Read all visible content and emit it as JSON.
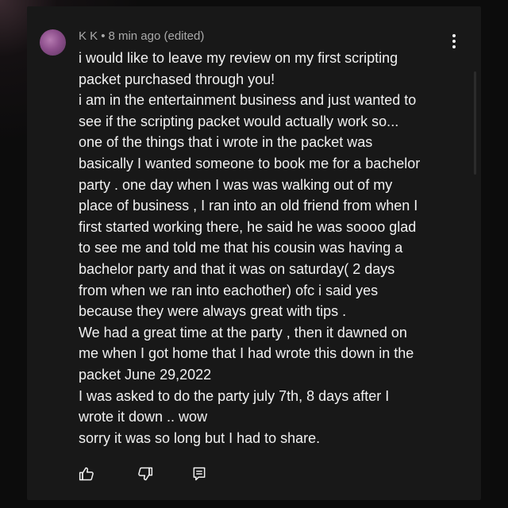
{
  "comment": {
    "author": "K K",
    "separator": "•",
    "timestamp": "8 min ago (edited)",
    "lines": [
      "i would like to leave my review on my first scripting",
      "packet purchased through you!",
      "i am in the entertainment business and just wanted to",
      "see if the scripting packet would actually work so...",
      "one of the things that i wrote in the packet was",
      "basically I wanted someone to book me for a bachelor",
      "party . one day when I was was walking out of my",
      "place of business , I ran into an old friend from when I",
      "first started working there, he said he was soooo glad",
      "to see me and told me that his cousin was having a",
      "bachelor party and that it was on saturday( 2 days",
      "from when we ran into eachother) ofc i said yes",
      "because they were always great with tips .",
      "We had a great time at the party , then it dawned on",
      "me when I got home that I had wrote this down in the",
      "packet June 29,2022",
      "I was asked to do the party july 7th, 8 days after I",
      "wrote it down .. wow",
      "sorry it was so long but I had to share."
    ]
  },
  "icons": {
    "more": "more-vertical-icon",
    "like": "thumbs-up-icon",
    "dislike": "thumbs-down-icon",
    "reply": "reply-icon"
  },
  "colors": {
    "background": "#181818",
    "text": "#f1f1f1",
    "meta": "#aaaaaa"
  }
}
